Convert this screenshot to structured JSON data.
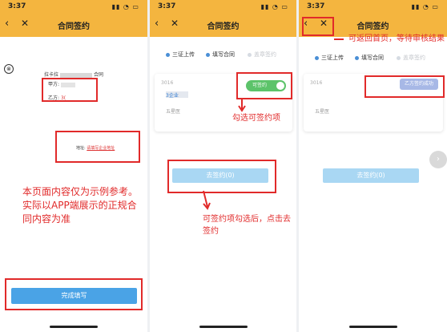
{
  "status": {
    "time": "3:37",
    "icons": "▮▮ ◔ ▭"
  },
  "nav": {
    "title": "合同签约",
    "back_icon": "‹",
    "close_icon": "✕"
  },
  "screen1": {
    "close_icon": "⊗",
    "doc_title_prefix": "拉卡拉",
    "doc_title_suffix": "合同",
    "party_a_label": "甲方:",
    "party_b_label": "乙方:",
    "party_b_value": "3(",
    "address_label": "地址:",
    "address_value": "请填写企业地址",
    "note": "本页面内容仅为示例参考。实际以APP端展示的正规合同内容为准",
    "finish_button": "完成填写"
  },
  "steps": [
    {
      "label": "三证上传",
      "active": true
    },
    {
      "label": "填写合同",
      "active": true
    },
    {
      "label": "盖章签约",
      "active": false
    }
  ],
  "screen2": {
    "card_code": "3016",
    "card_name": "3企业",
    "card_org": "五星医",
    "toggle_label": "可签约",
    "annotation_toggle": "勾选可签约项",
    "sign_button": "去签约(0)",
    "annotation_sign": "可签约项勾选后，点击去签约"
  },
  "screen3": {
    "card_code": "3016",
    "card_org": "五星医",
    "signed_label": "乙方签约成功",
    "sign_button": "去签约(0)",
    "annotation_back": "可返回首页，等待审核结果",
    "side_icon": "›"
  }
}
